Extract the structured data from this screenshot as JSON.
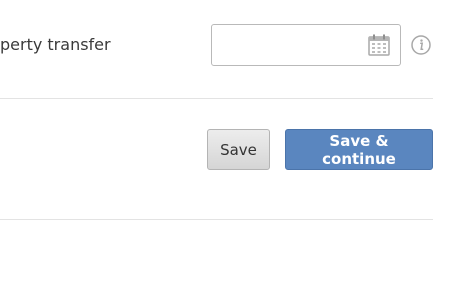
{
  "form": {
    "field_label": "perty transfer",
    "date_value": "",
    "calendar_icon": "calendar-icon",
    "info_icon": "info-icon"
  },
  "actions": {
    "save_label": "Save",
    "save_continue_label": "Save & continue"
  },
  "colors": {
    "primary_button": "#5a86bf",
    "secondary_button": "#e0e0e0",
    "divider": "#e3e3e3"
  }
}
